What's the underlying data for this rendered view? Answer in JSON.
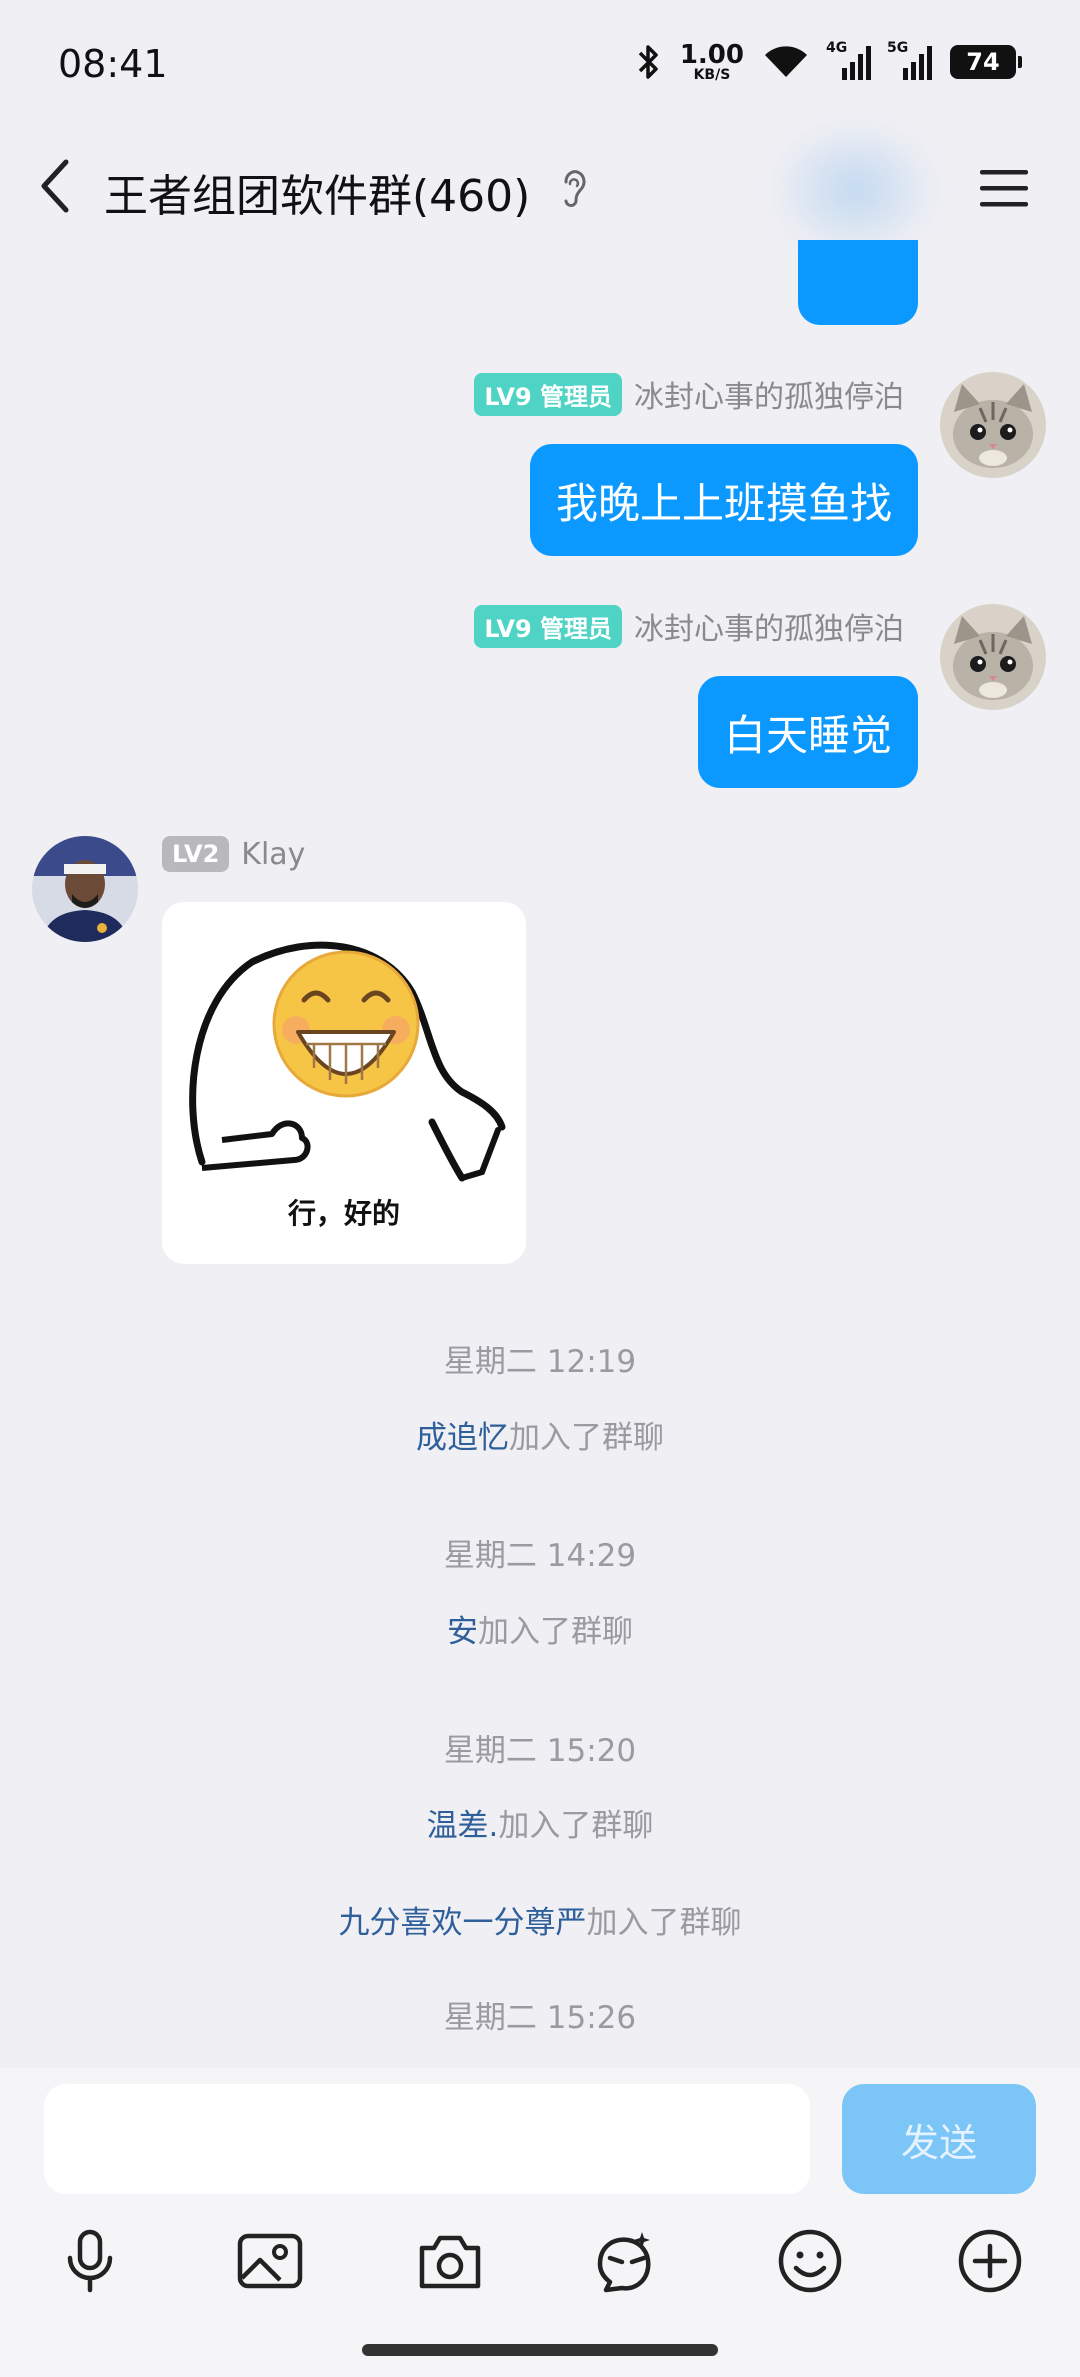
{
  "status_bar": {
    "time": "08:41",
    "net_speed": "1.00",
    "net_unit": "KB/S",
    "sig1_label": "4G",
    "sig2_label": "5G",
    "battery": "74"
  },
  "header": {
    "title": "王者组团软件群(460)"
  },
  "messages": [
    {
      "badge": "LV9 管理员",
      "sender": "冰封心事的孤独停泊",
      "text": "我晚上上班摸鱼找"
    },
    {
      "badge": "LV9 管理员",
      "sender": "冰封心事的孤独停泊",
      "text": "白天睡觉"
    },
    {
      "badge": "LV2",
      "sender": "Klay",
      "sticker_caption": "行，好的"
    }
  ],
  "system": [
    {
      "time": "星期二 12:19",
      "name": "成追忆",
      "action": "加入了群聊"
    },
    {
      "time": "星期二 14:29",
      "name": "安",
      "action": "加入了群聊"
    },
    {
      "time": "星期二 15:20",
      "name": "温差.",
      "action": "加入了群聊"
    },
    {
      "name": "九分喜欢一分尊严",
      "action": "加入了群聊"
    },
    {
      "time": "星期二 15:26"
    }
  ],
  "input": {
    "placeholder": "",
    "send_label": "发送"
  },
  "colors": {
    "bubble": "#0b99ff",
    "admin_badge": "#4fd3c4",
    "name_link": "#2f5f9a",
    "send_button": "#7cc6f7"
  },
  "icons": [
    "back-icon",
    "ear-icon",
    "menu-icon",
    "mic-icon",
    "image-icon",
    "camera-icon",
    "emoji-face-icon",
    "smiley-icon",
    "plus-icon"
  ]
}
